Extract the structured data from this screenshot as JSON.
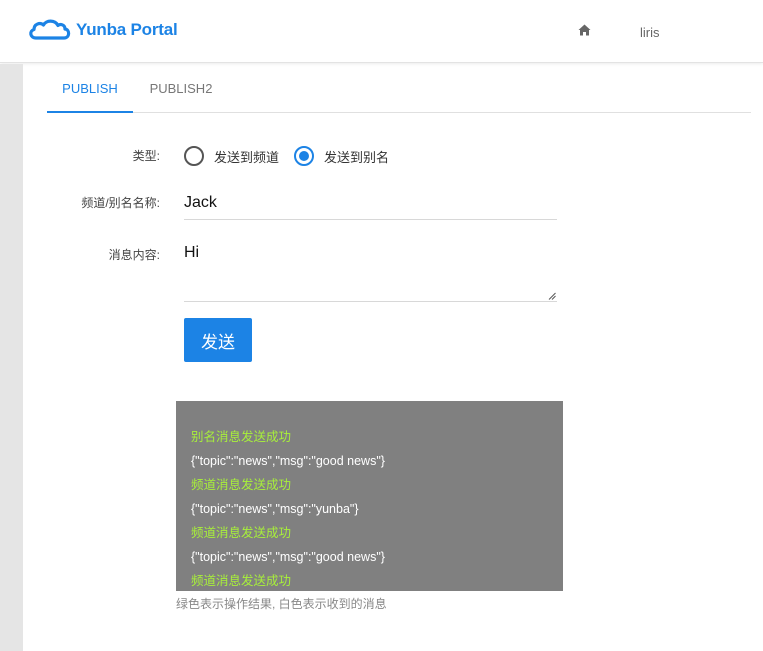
{
  "header": {
    "brand": "Yunba Portal",
    "home_icon": "home-icon",
    "user": "liris",
    "brand_color": "#1c83e5"
  },
  "tabs": [
    {
      "label": "PUBLISH",
      "active": true
    },
    {
      "label": "PUBLISH2",
      "active": false
    }
  ],
  "form": {
    "type_label": "类型:",
    "radio_options": [
      {
        "label": "发送到频道",
        "checked": false
      },
      {
        "label": "发送到别名",
        "checked": true
      }
    ],
    "name_label": "频道/别名名称:",
    "name_value": "Jack",
    "message_label": "消息内容:",
    "message_value": "Hi",
    "send_label": "发送"
  },
  "log": {
    "lines": [
      {
        "text": "别名消息发送成功",
        "kind": "green"
      },
      {
        "text": "{\"topic\":\"news\",\"msg\":\"good news\"}",
        "kind": "white"
      },
      {
        "text": "频道消息发送成功",
        "kind": "green"
      },
      {
        "text": "{\"topic\":\"news\",\"msg\":\"yunba\"}",
        "kind": "white"
      },
      {
        "text": "频道消息发送成功",
        "kind": "green"
      },
      {
        "text": "{\"topic\":\"news\",\"msg\":\"good news\"}",
        "kind": "white"
      },
      {
        "text": "频道消息发送成功",
        "kind": "green"
      }
    ],
    "hint": "绿色表示操作结果, 白色表示收到的消息",
    "green_color": "#a8f03a",
    "background_color": "#808080"
  }
}
